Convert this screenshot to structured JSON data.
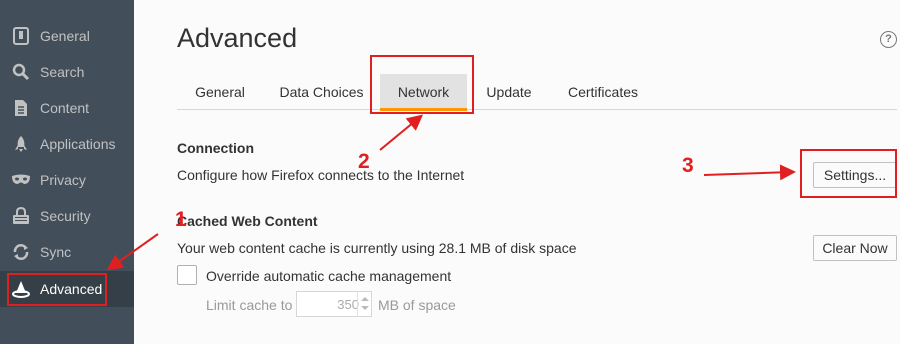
{
  "sidebar": {
    "items": [
      {
        "label": "General",
        "icon": "general-icon"
      },
      {
        "label": "Search",
        "icon": "search-icon"
      },
      {
        "label": "Content",
        "icon": "content-icon"
      },
      {
        "label": "Applications",
        "icon": "applications-icon"
      },
      {
        "label": "Privacy",
        "icon": "privacy-mask-icon"
      },
      {
        "label": "Security",
        "icon": "security-icon"
      },
      {
        "label": "Sync",
        "icon": "sync-icon"
      },
      {
        "label": "Advanced",
        "icon": "advanced-wizard-hat-icon",
        "selected": true
      }
    ]
  },
  "header": {
    "title": "Advanced",
    "help": "?"
  },
  "tabs": [
    {
      "label": "General"
    },
    {
      "label": "Data Choices"
    },
    {
      "label": "Network",
      "selected": true
    },
    {
      "label": "Update"
    },
    {
      "label": "Certificates"
    }
  ],
  "connection": {
    "title": "Connection",
    "description": "Configure how Firefox connects to the Internet",
    "settings_button": "Settings..."
  },
  "cache": {
    "title": "Cached Web Content",
    "description": "Your web content cache is currently using 28.1 MB of disk space",
    "clear_button": "Clear Now",
    "override_label": "Override automatic cache management",
    "limit_label": "Limit cache to",
    "limit_value": "350",
    "limit_unit": "MB of space"
  },
  "annotations": {
    "step1": "1",
    "step2": "2",
    "step3": "3",
    "color": "#e02020"
  },
  "colors": {
    "sidebar_bg": "#424f5a",
    "sidebar_selected": "#343f48",
    "tab_accent": "#ff9500"
  }
}
